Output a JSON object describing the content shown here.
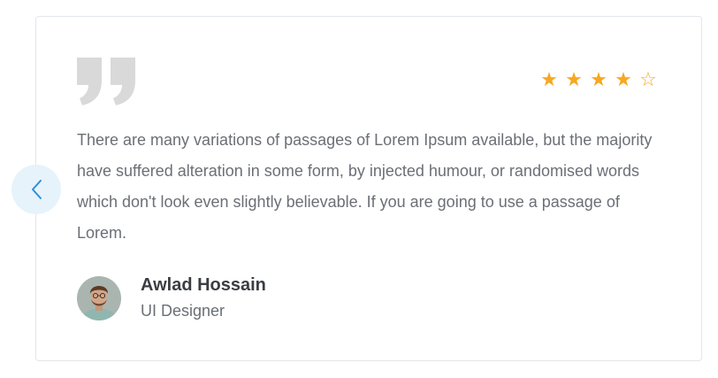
{
  "testimonial": {
    "quote_icon": "double-quote-icon",
    "rating": {
      "value": 4,
      "max": 5,
      "filled_star": "★",
      "empty_star": "☆",
      "color": "#f6a821"
    },
    "text": "There are many variations of passages of Lorem Ipsum available, but the majority have suffered alteration in some form, by injected humour, or randomised words which don't look even slightly believable. If you are going to use a passage of Lorem.",
    "author": {
      "name": "Awlad Hossain",
      "role": "UI Designer"
    }
  },
  "navigation": {
    "prev_icon": "chevron-left-icon",
    "accent_color": "#2f8fd6"
  }
}
